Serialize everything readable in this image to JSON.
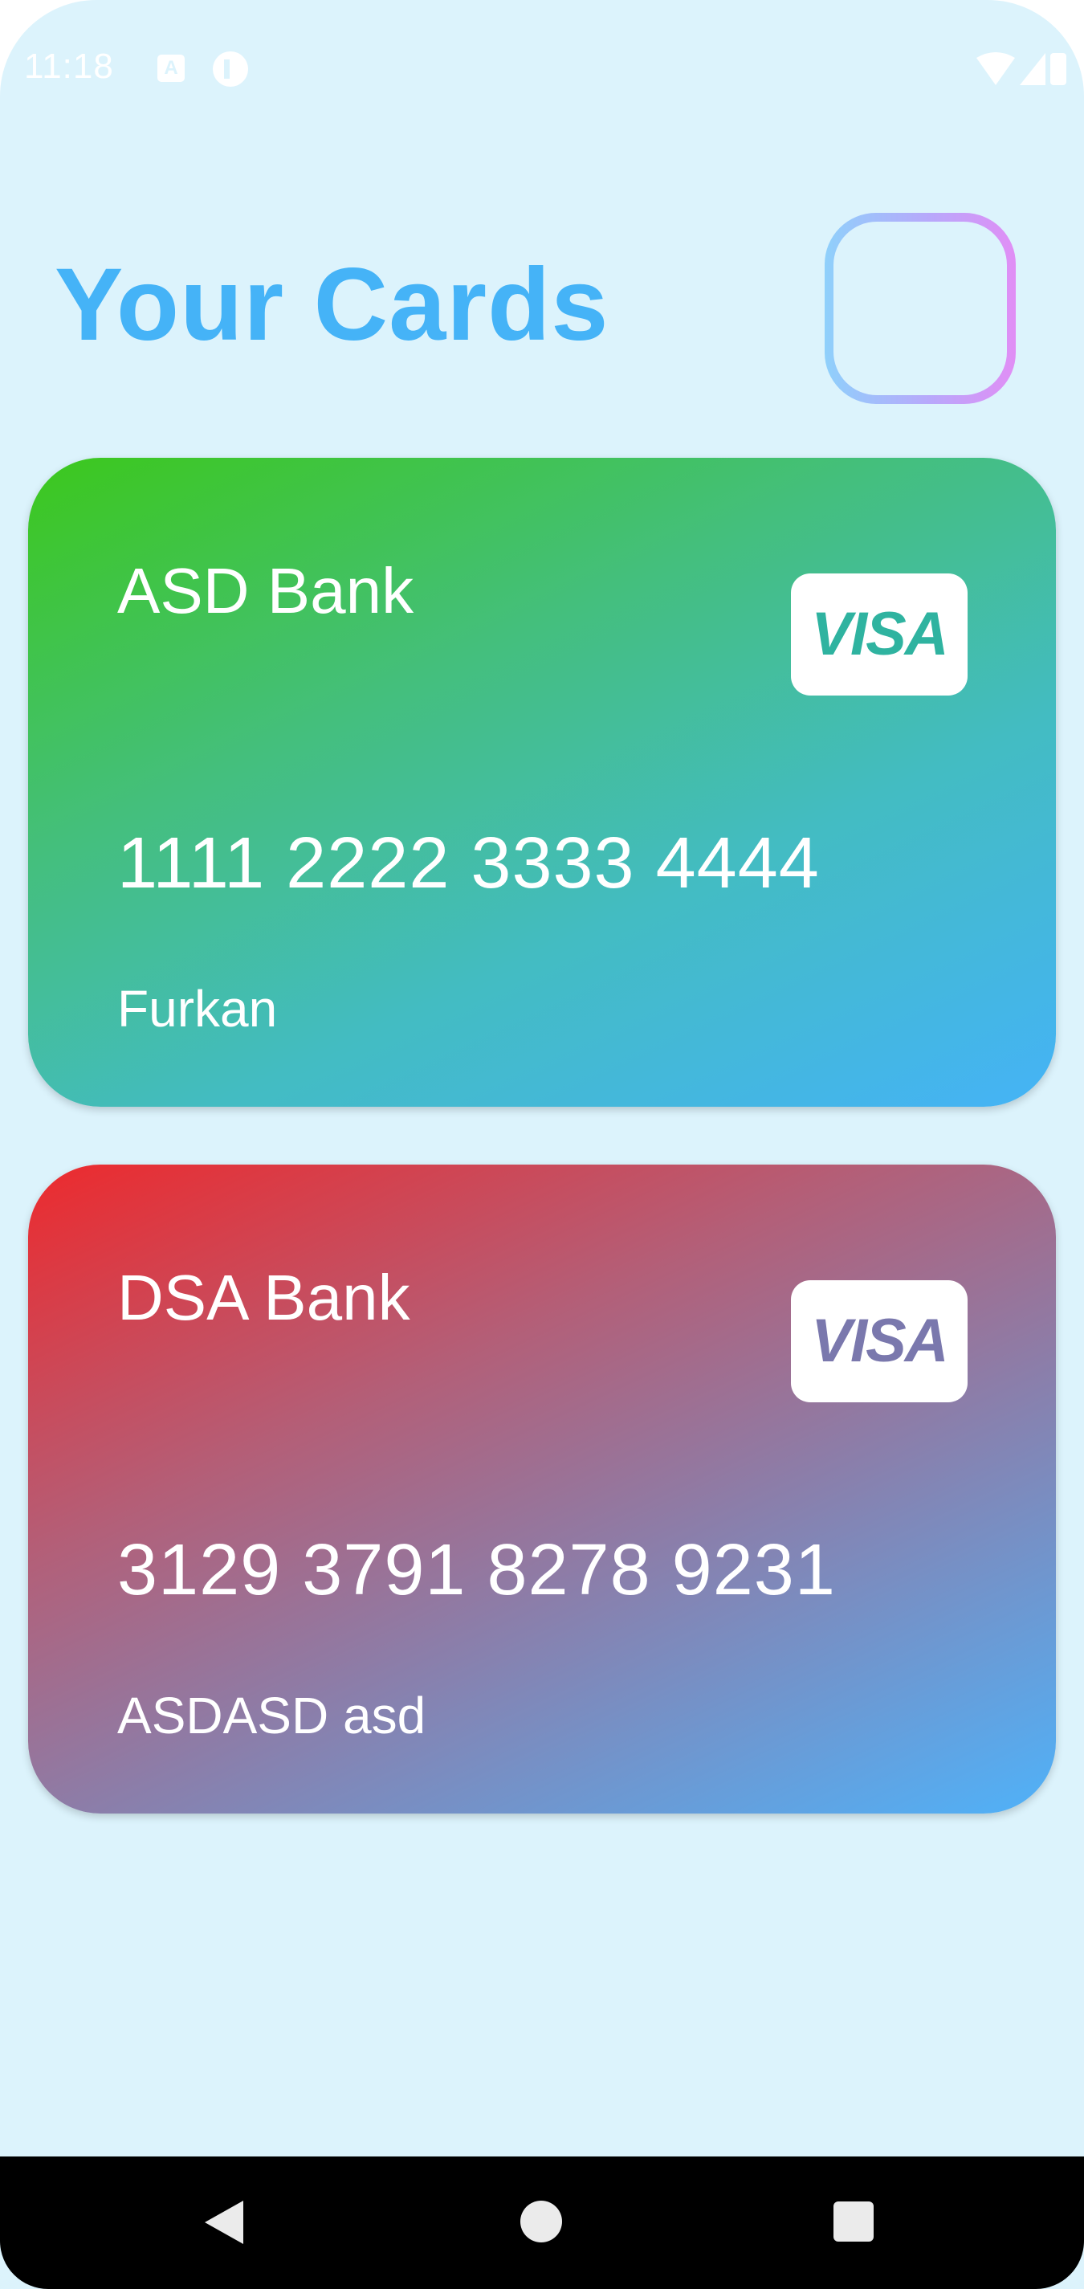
{
  "status_bar": {
    "time": "11:18",
    "icons": [
      "a-notification-icon",
      "app-notification-icon",
      "wifi-icon",
      "signal-icon",
      "battery-icon"
    ]
  },
  "header": {
    "title": "Your Cards",
    "add_button_icon": "plus-icon"
  },
  "cards": [
    {
      "bank": "ASD Bank",
      "number": "1111 2222 3333 4444",
      "holder": "Furkan",
      "network": "VISA",
      "gradient": [
        "#3cc81c",
        "#45b3f7"
      ]
    },
    {
      "bank": "DSA Bank",
      "number": "3129 3791 8278 9231",
      "holder": "ASDASD asd",
      "network": "VISA",
      "gradient": [
        "#ed2a2d",
        "#4fb2f9"
      ]
    }
  ],
  "colors": {
    "background": "#dcf3fc",
    "title": "#45b3f7",
    "add_button_gradient": [
      "#8fd0fb",
      "#e18ef5"
    ]
  },
  "nav_bar": {
    "icons": [
      "back-icon",
      "home-icon",
      "recents-icon"
    ]
  }
}
